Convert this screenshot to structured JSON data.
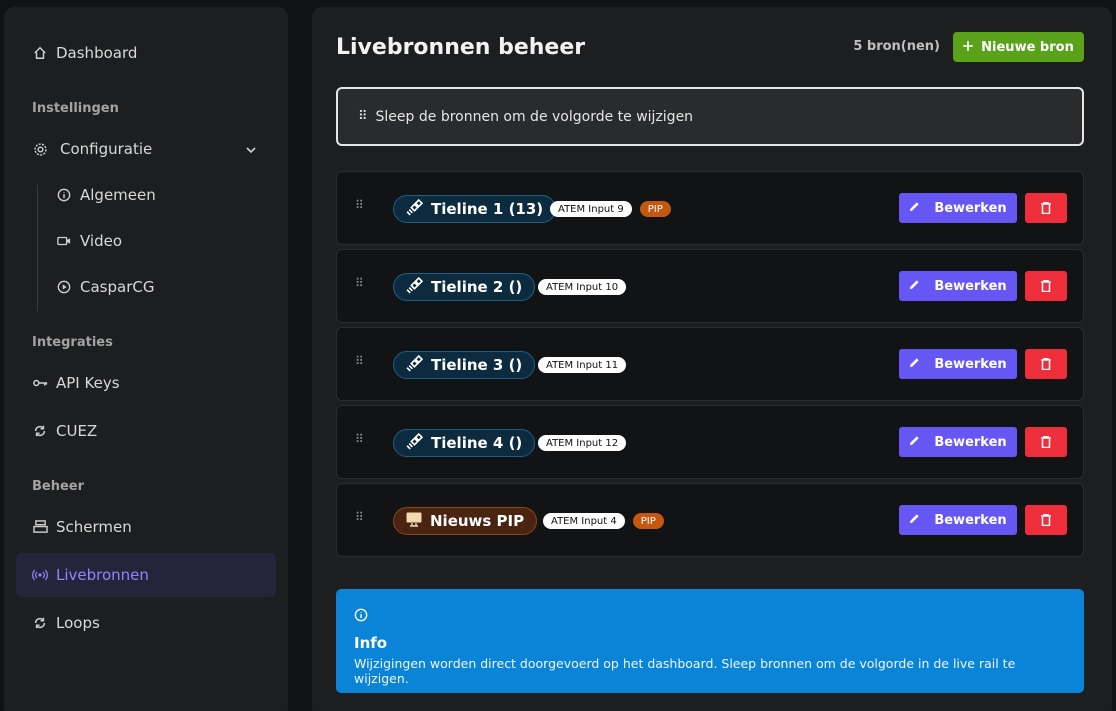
{
  "sidebar": {
    "dashboard": "Dashboard",
    "sections": {
      "settings": "Instellingen",
      "integrations": "Integraties",
      "management": "Beheer"
    },
    "configuratie": "Configuratie",
    "sub_items": [
      "Algemeen",
      "Video",
      "CasparCG"
    ],
    "api_keys": "API Keys",
    "cuez": "CUEZ",
    "schermen": "Schermen",
    "livebronnen": "Livebronnen",
    "loops": "Loops"
  },
  "main": {
    "title": "Livebronnen beheer",
    "count": "5 bron(nen)",
    "new_button": "Nieuwe bron",
    "drag_hint": "Sleep de bronnen om de volgorde te wijzigen",
    "rows": [
      {
        "name": "Tieline 1 (13)",
        "icon": "satellite-icon",
        "atem": "ATEM Input 9",
        "pip": "PIP"
      },
      {
        "name": "Tieline 2 ()",
        "icon": "satellite-icon",
        "atem": "ATEM Input 10"
      },
      {
        "name": "Tieline 3 ()",
        "icon": "satellite-icon",
        "atem": "ATEM Input 11"
      },
      {
        "name": "Tieline 4 ()",
        "icon": "satellite-icon",
        "atem": "ATEM Input 12"
      },
      {
        "name": "Nieuws PIP",
        "icon": "monitor-icon",
        "atem": "ATEM Input 4",
        "pip": "PIP"
      }
    ],
    "edit_label": "Bewerken",
    "info": {
      "title": "Info",
      "text": "Wijzigingen worden direct doorgevoerd op het dashboard. Sleep bronnen om de volgorde in de live rail te wijzigen."
    }
  },
  "colors": {
    "accent": "#6657f5",
    "success": "#5aa21a",
    "danger": "#ef2e3b",
    "info": "#0a84d6",
    "pip": "#c5580e"
  }
}
